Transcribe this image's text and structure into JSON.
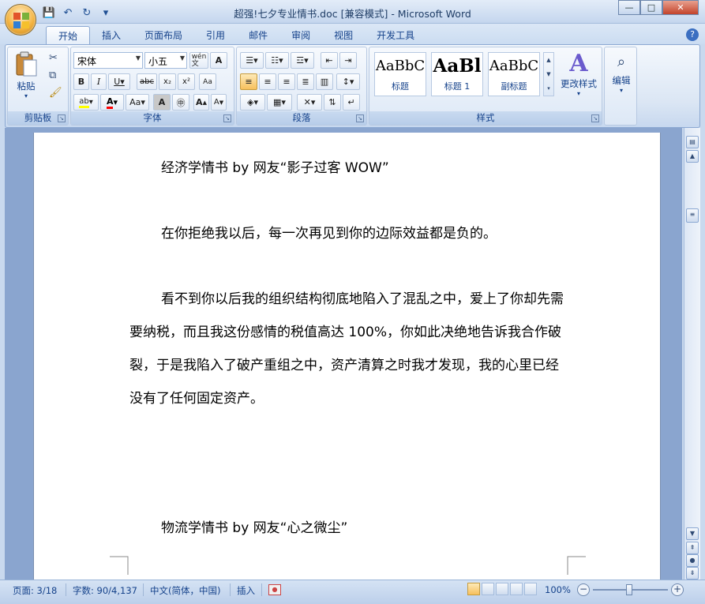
{
  "window": {
    "title": "超强!七夕专业情书.doc [兼容模式] - Microsoft Word",
    "minimize": "—",
    "maximize": "□",
    "close": "✕"
  },
  "qat": {
    "save": "💾",
    "undo": "↶",
    "redo": "↻",
    "more": "▾"
  },
  "tabs": [
    "开始",
    "插入",
    "页面布局",
    "引用",
    "邮件",
    "审阅",
    "视图",
    "开发工具"
  ],
  "ribbon": {
    "clipboard": {
      "paste": "粘贴",
      "label": "剪贴板"
    },
    "font": {
      "name": "宋体",
      "size": "小五",
      "label": "字体",
      "wen": "wén\n文"
    },
    "paragraph": {
      "label": "段落"
    },
    "styles": {
      "label": "样式",
      "items": [
        {
          "sample": "AaBbC",
          "name": "标题"
        },
        {
          "sample": "AaBl",
          "name": "标题 1"
        },
        {
          "sample": "AaBbC",
          "name": "副标题"
        }
      ],
      "change_styles": "更改样式"
    },
    "editing": {
      "label": "编辑"
    }
  },
  "document": {
    "p1": "经济学情书  by  网友“影子过客 WOW”",
    "p2": "在你拒绝我以后，每一次再见到你的边际效益都是负的。",
    "p3": "看不到你以后我的组织结构彻底地陷入了混乱之中，爱上了你却先需要纳税，而且我这份感情的税值高达 100%，你如此决绝地告诉我合作破裂，于是我陷入了破产重组之中，资产清算之时我才发现，我的心里已经没有了任何固定资产。",
    "p4": "物流学情书  by  网友“心之微尘”"
  },
  "status": {
    "page": "页面: 3/18",
    "words": "字数: 90/4,137",
    "language": "中文(简体，中国)",
    "insert": "插入",
    "zoom": "100%"
  },
  "colors": {
    "highlight": "#ffff00",
    "font_color": "#ff0000"
  }
}
